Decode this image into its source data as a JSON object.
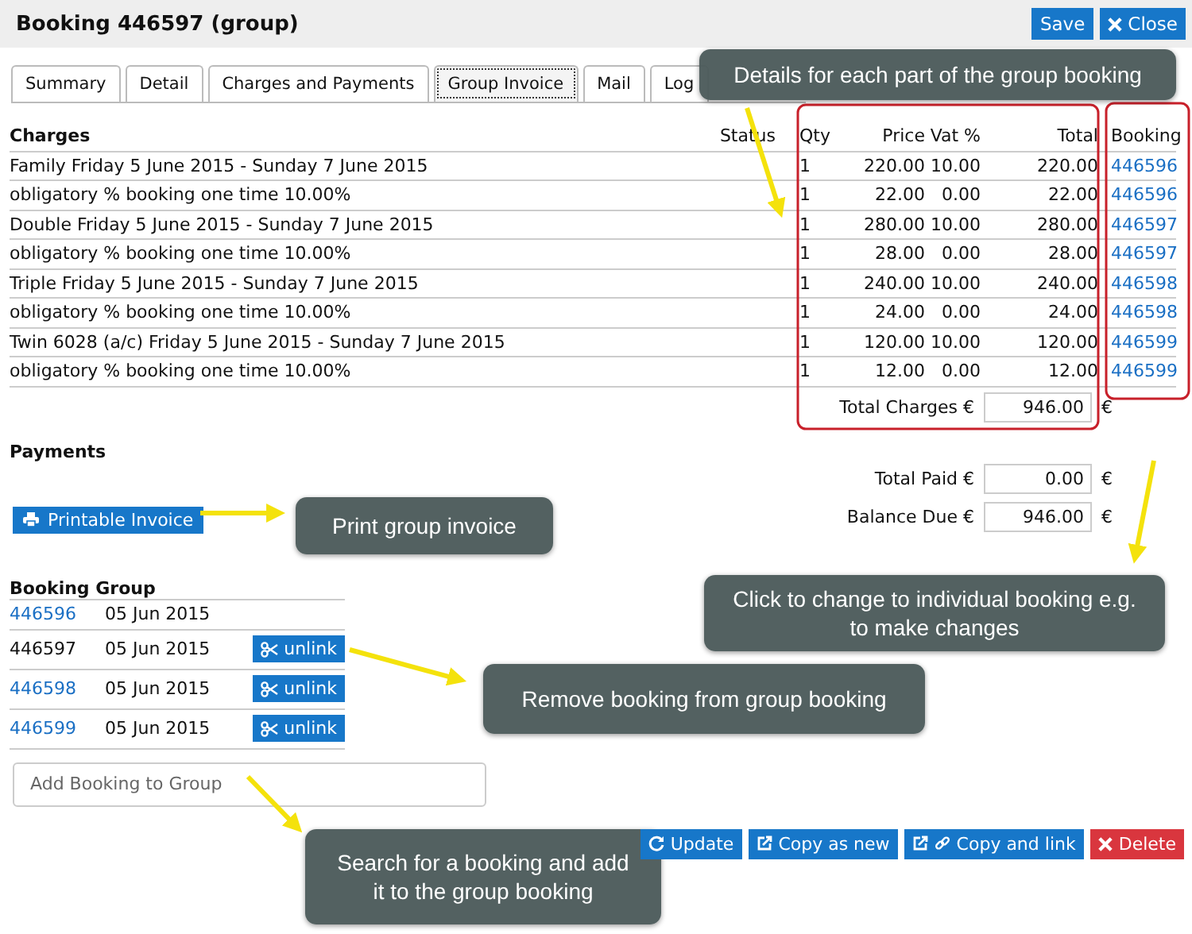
{
  "header": {
    "title": "Booking 446597 (group)",
    "buttons": [
      {
        "label": "Save",
        "kind": "save"
      },
      {
        "label": "Close",
        "kind": "close"
      }
    ]
  },
  "tabs": [
    {
      "label": "Summary",
      "selected": false
    },
    {
      "label": "Detail",
      "selected": false
    },
    {
      "label": "Charges and Payments",
      "selected": false
    },
    {
      "label": "Group Invoice",
      "selected": true
    },
    {
      "label": "Mail",
      "selected": false
    },
    {
      "label": "Log",
      "selected": false
    }
  ],
  "charges": {
    "columns": [
      "Charges",
      "Status",
      "Qty",
      "Price",
      "Vat %",
      "Total",
      "Booking"
    ],
    "rows": [
      {
        "description": "Family Friday 5 June 2015 - Sunday 7 June 2015",
        "qty": "1",
        "price": "220.00",
        "vat": "10.00",
        "total": "220.00",
        "booking": "446596"
      },
      {
        "description": "obligatory % booking one time 10.00%",
        "qty": "1",
        "price": "22.00",
        "vat": "0.00",
        "total": "22.00",
        "booking": "446596"
      },
      {
        "description": "Double Friday 5 June 2015 - Sunday 7 June 2015",
        "qty": "1",
        "price": "280.00",
        "vat": "10.00",
        "total": "280.00",
        "booking": "446597"
      },
      {
        "description": "obligatory % booking one time 10.00%",
        "qty": "1",
        "price": "28.00",
        "vat": "0.00",
        "total": "28.00",
        "booking": "446597"
      },
      {
        "description": "Triple Friday 5 June 2015 - Sunday 7 June 2015",
        "qty": "1",
        "price": "240.00",
        "vat": "10.00",
        "total": "240.00",
        "booking": "446598"
      },
      {
        "description": "obligatory % booking one time 10.00%",
        "qty": "1",
        "price": "24.00",
        "vat": "0.00",
        "total": "24.00",
        "booking": "446598"
      },
      {
        "description": "Twin 6028 (a/c) Friday 5 June 2015 - Sunday 7 June 2015",
        "qty": "1",
        "price": "120.00",
        "vat": "10.00",
        "total": "120.00",
        "booking": "446599"
      },
      {
        "description": "obligatory % booking one time 10.00%",
        "qty": "1",
        "price": "12.00",
        "vat": "0.00",
        "total": "12.00",
        "booking": "446599"
      }
    ],
    "total": {
      "label": "Total Charges €",
      "value": "946.00",
      "currency": "€"
    }
  },
  "payments": {
    "title": "Payments",
    "print_button": "Printable Invoice",
    "totals": [
      {
        "label": "Total Paid €",
        "value": "0.00",
        "currency": "€"
      },
      {
        "label": "Balance Due €",
        "value": "946.00",
        "currency": "€"
      }
    ]
  },
  "booking_group": {
    "title": "Booking Group",
    "items": [
      {
        "booking": "446596",
        "link": true,
        "date": "05 Jun 2015"
      },
      {
        "booking": "446597",
        "link": false,
        "date": "05 Jun 2015",
        "unlink": "unlink"
      },
      {
        "booking": "446598",
        "link": true,
        "date": "05 Jun 2015",
        "unlink": "unlink"
      },
      {
        "booking": "446599",
        "link": true,
        "date": "05 Jun 2015",
        "unlink": "unlink"
      }
    ],
    "add_field": {
      "placeholder": "Add Booking to Group"
    }
  },
  "actions": [
    {
      "label": "Update",
      "kind": "update"
    },
    {
      "label": "Copy as new",
      "kind": "copy"
    },
    {
      "label": "Copy and link",
      "kind": "copylink"
    },
    {
      "label": "Delete",
      "kind": "delete"
    }
  ],
  "callouts": [
    {
      "text": "Details for each part of the group booking"
    },
    {
      "text": "Click to change to individual booking e.g. to make changes"
    },
    {
      "text": "Print group invoice"
    },
    {
      "text": "Remove booking from group booking"
    },
    {
      "text": "Search for a booking and add it to the group booking"
    }
  ]
}
